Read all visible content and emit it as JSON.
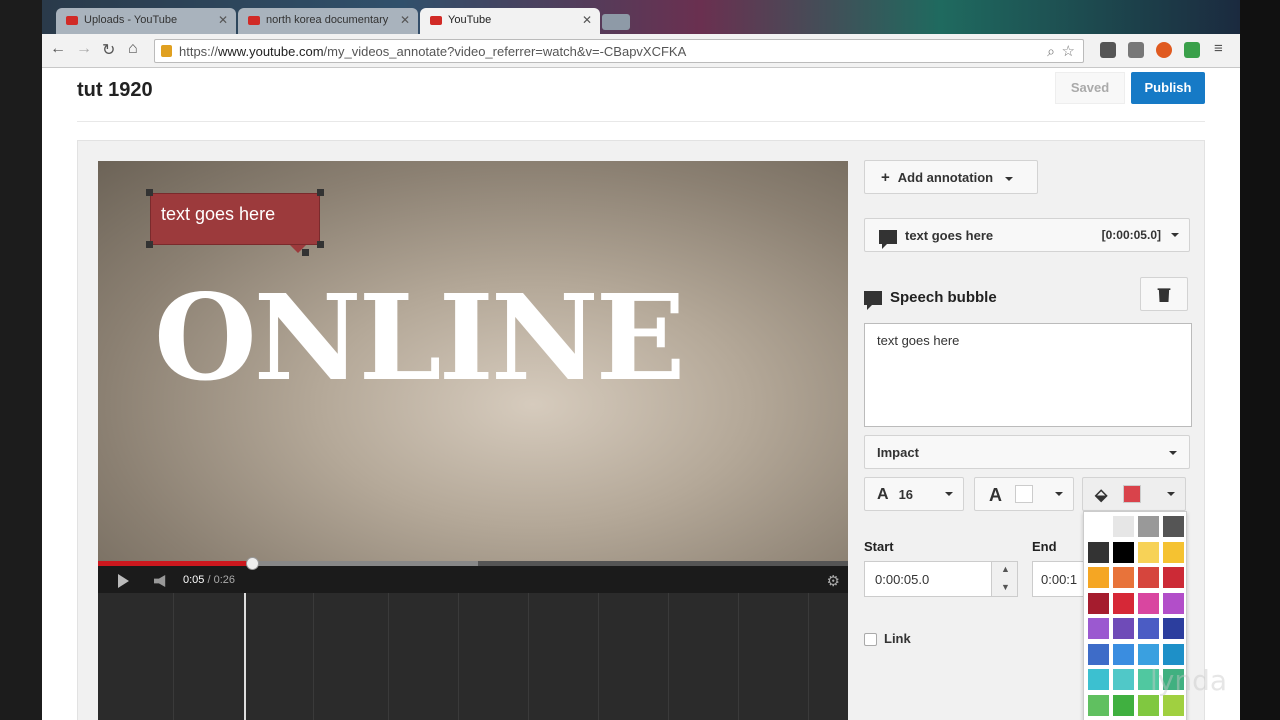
{
  "browser": {
    "tabs": [
      {
        "title": "Uploads - YouTube",
        "active": false
      },
      {
        "title": "north korea documentary",
        "active": false
      },
      {
        "title": "YouTube",
        "active": true
      }
    ],
    "url_prefix": "https://",
    "url_domain": "www.youtube.com",
    "url_path": "/my_videos_annotate?video_referrer=watch&v=-CBapvXCFKA"
  },
  "page": {
    "video_title": "tut 1920",
    "saved_label": "Saved",
    "publish_label": "Publish"
  },
  "player": {
    "overlay_word": "ONLINE",
    "bubble_text": "text goes here",
    "current_time": "0:05",
    "duration": "/ 0:26",
    "progress_fraction": 0.205
  },
  "panel": {
    "add_annotation_label": "Add annotation",
    "selected_annotation": "text goes here",
    "selected_annotation_time": "[0:00:05.0]",
    "annotation_type": "Speech bubble",
    "annotation_text": "text goes here",
    "font": "Impact",
    "font_size": "16",
    "text_color": "#ffffff",
    "fill_color": "#d9434b",
    "start_label": "Start",
    "end_label": "End",
    "start_value": "0:00:05.0",
    "end_value": "0:00:1",
    "link_label": "Link"
  },
  "palette_colors": [
    "#ffffff",
    "#e6e6e6",
    "#999999",
    "#555555",
    "#333333",
    "#000000",
    "#f7d257",
    "#f5c231",
    "#f5a623",
    "#e8733a",
    "#d6453d",
    "#cc2a36",
    "#a51c2e",
    "#d62837",
    "#d946a0",
    "#b24ec9",
    "#9b59d0",
    "#6f4bb8",
    "#4b5cc4",
    "#2c3e9e",
    "#3e6cc8",
    "#3a8de0",
    "#3aa0e0",
    "#1e90c8",
    "#3cc0d0",
    "#50c8c8",
    "#50c8a0",
    "#40b080",
    "#60c060",
    "#40b040",
    "#80c840",
    "#a0d040"
  ],
  "watermark": "lynda"
}
